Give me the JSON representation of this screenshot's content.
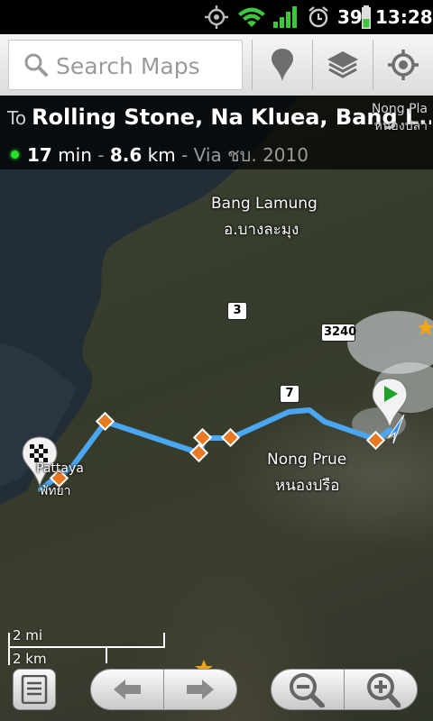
{
  "status_bar": {
    "battery": "39",
    "time": "13:28"
  },
  "search": {
    "placeholder": "Search Maps"
  },
  "toolbar": {
    "buttons": [
      {
        "name": "places",
        "icon": "map-pin-icon"
      },
      {
        "name": "layers",
        "icon": "layers-icon"
      },
      {
        "name": "my-location",
        "icon": "target-icon"
      }
    ]
  },
  "directions": {
    "to_label": "To",
    "destination": "Rolling Stone, Na Kluea, Bang L...",
    "duration_value": "17",
    "duration_unit": "min",
    "separator": "-",
    "distance_value": "8.6",
    "distance_unit": "km",
    "via_text": "Via ชบ. 2010"
  },
  "map": {
    "labels": {
      "bang_lamung": "Bang Lamung",
      "bang_lamung_thai": "อ.บางละมุง",
      "nong_prue": "Nong Prue",
      "nong_prue_thai": "หนองปรือ",
      "pattaya": "Pattaya",
      "pattaya_thai": "พัทยา",
      "nong_pla_partial": "Nong Pla",
      "nong_pla_thai_partial": "หนองปลา"
    },
    "shields": {
      "road_3": "3",
      "road_3240": "3240",
      "road_7": "7"
    },
    "scale": {
      "miles": "2 mi",
      "km": "2 km"
    },
    "colors": {
      "route": "#4aa6f0",
      "waypoint": "#e87822",
      "start_pin": "#1fa12a",
      "star": "#f2a413"
    }
  }
}
